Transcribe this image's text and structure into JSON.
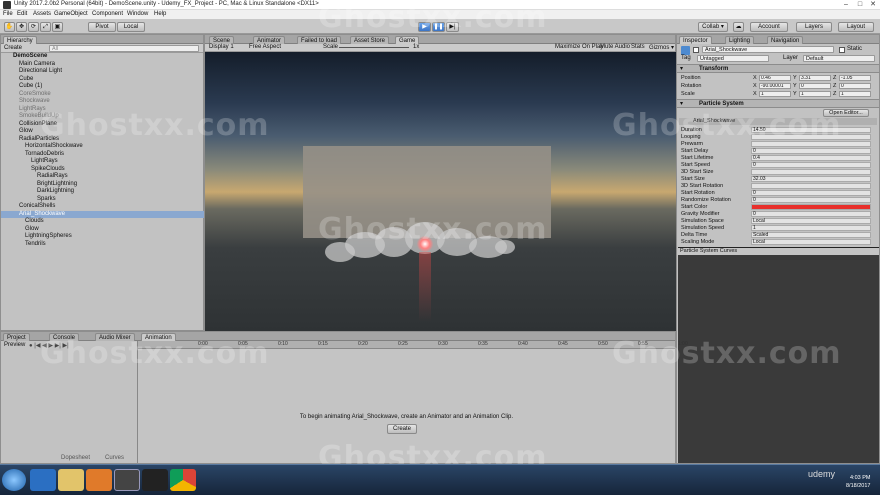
{
  "window": {
    "title": "Unity 2017.2.0b2 Personal (64bit) - DemoScene.unity - Udemy_FX_Project - PC, Mac & Linux Standalone <DX11>"
  },
  "menu": [
    "File",
    "Edit",
    "Assets",
    "GameObject",
    "Component",
    "Window",
    "Help"
  ],
  "toolbar": {
    "pivot": "Pivot",
    "local": "Local",
    "collab": "Collab ▾",
    "account": "Account",
    "layers": "Layers",
    "layout": "Layout"
  },
  "hierarchy": {
    "tab": "Hierarchy",
    "create": "Create",
    "search_placeholder": "All",
    "items": [
      {
        "label": "DemoScene",
        "indent": 0,
        "state": "bold"
      },
      {
        "label": "Main Camera",
        "indent": 1,
        "state": ""
      },
      {
        "label": "Directional Light",
        "indent": 1,
        "state": ""
      },
      {
        "label": "Cube",
        "indent": 1,
        "state": ""
      },
      {
        "label": "Cube (1)",
        "indent": 1,
        "state": ""
      },
      {
        "label": "CoreSmoke",
        "indent": 1,
        "state": "dim"
      },
      {
        "label": "Shockwave",
        "indent": 1,
        "state": "dim"
      },
      {
        "label": "LightRays",
        "indent": 1,
        "state": "dim"
      },
      {
        "label": "SmokeBuildUp",
        "indent": 1,
        "state": "dim"
      },
      {
        "label": "CollisionPlane",
        "indent": 1,
        "state": ""
      },
      {
        "label": "Glow",
        "indent": 1,
        "state": ""
      },
      {
        "label": "RadialParticles",
        "indent": 1,
        "state": ""
      },
      {
        "label": "HorizontalShockwave",
        "indent": 2,
        "state": ""
      },
      {
        "label": "TornadoDebris",
        "indent": 2,
        "state": ""
      },
      {
        "label": "LightRays",
        "indent": 3,
        "state": ""
      },
      {
        "label": "SpikeClouds",
        "indent": 3,
        "state": ""
      },
      {
        "label": "RadialRays",
        "indent": 4,
        "state": ""
      },
      {
        "label": "BrightLightning",
        "indent": 4,
        "state": ""
      },
      {
        "label": "DarkLightning",
        "indent": 4,
        "state": ""
      },
      {
        "label": "Sparks",
        "indent": 4,
        "state": ""
      },
      {
        "label": "ConicalShells",
        "indent": 1,
        "state": ""
      },
      {
        "label": "Arial_Shockwave",
        "indent": 1,
        "state": "sel"
      },
      {
        "label": "Clouds",
        "indent": 2,
        "state": ""
      },
      {
        "label": "Glow",
        "indent": 2,
        "state": ""
      },
      {
        "label": "LightningSpheres",
        "indent": 2,
        "state": ""
      },
      {
        "label": "Tendrils",
        "indent": 2,
        "state": ""
      }
    ]
  },
  "center_tabs": [
    "Scene",
    "Animator",
    "Failed to load",
    "Asset Store",
    "Game"
  ],
  "game": {
    "display": "Display 1",
    "aspect": "Free Aspect",
    "scale_label": "Scale",
    "scale_value": "1x",
    "toggles": [
      "Maximize On Play",
      "Mute Audio",
      "Stats",
      "Gizmos ▾"
    ]
  },
  "inspector": {
    "tabs": [
      "Inspector",
      "Lighting",
      "Navigation"
    ],
    "object_name": "Arial_Shockwave",
    "static": "Static",
    "tag_label": "Tag",
    "tag": "Untagged",
    "layer_label": "Layer",
    "layer": "Default",
    "transform": {
      "title": "Transform",
      "rows": [
        {
          "label": "Position",
          "x": "0.46",
          "y": "3.31",
          "z": "-1.05"
        },
        {
          "label": "Rotation",
          "x": "-90.00001",
          "y": "0",
          "z": "0"
        },
        {
          "label": "Scale",
          "x": "1",
          "y": "1",
          "z": "1"
        }
      ]
    },
    "particle_system": {
      "title": "Particle System",
      "open_editor": "Open Editor...",
      "module": "Arial_Shockwave",
      "rows": [
        {
          "label": "Duration",
          "value": "14.50"
        },
        {
          "label": "Looping",
          "value": ""
        },
        {
          "label": "Prewarm",
          "value": ""
        },
        {
          "label": "Start Delay",
          "value": "0"
        },
        {
          "label": "Start Lifetime",
          "value": "0.4"
        },
        {
          "label": "Start Speed",
          "value": "0"
        },
        {
          "label": "3D Start Size",
          "value": ""
        },
        {
          "label": "Start Size",
          "value": "32.03"
        },
        {
          "label": "3D Start Rotation",
          "value": ""
        },
        {
          "label": "Start Rotation",
          "value": "0"
        },
        {
          "label": "Randomize Rotation",
          "value": "0"
        },
        {
          "label": "Start Color",
          "value": ""
        },
        {
          "label": "Gravity Modifier",
          "value": "0"
        },
        {
          "label": "Simulation Space",
          "value": "Local"
        },
        {
          "label": "Simulation Speed",
          "value": "1"
        },
        {
          "label": "Delta Time",
          "value": "Scaled"
        },
        {
          "label": "Scaling Mode",
          "value": "Local"
        }
      ]
    },
    "curves_title": "Particle System Curves"
  },
  "bottom_tabs": [
    "Project",
    "Console",
    "Audio Mixer",
    "Animation"
  ],
  "animation": {
    "preview": "Preview",
    "message": "To begin animating Arial_Shockwave, create an Animator and an Animation Clip.",
    "create": "Create",
    "dopesheet": "Dopesheet",
    "curves": "Curves",
    "ruler": [
      "0:00",
      "0:05",
      "0:10",
      "0:15",
      "0:20",
      "0:25",
      "0:30",
      "0:35",
      "0:40",
      "0:45",
      "0:50",
      "0:55",
      "1:00"
    ]
  },
  "watermark": "Ghostxx.com",
  "taskbar": {
    "time": "4:03 PM",
    "date": "8/18/2017",
    "brand": "udemy"
  },
  "colors": {
    "start_color": "#e8302c",
    "selection": "#8aa8d0",
    "play_active": "#3b74c5"
  }
}
